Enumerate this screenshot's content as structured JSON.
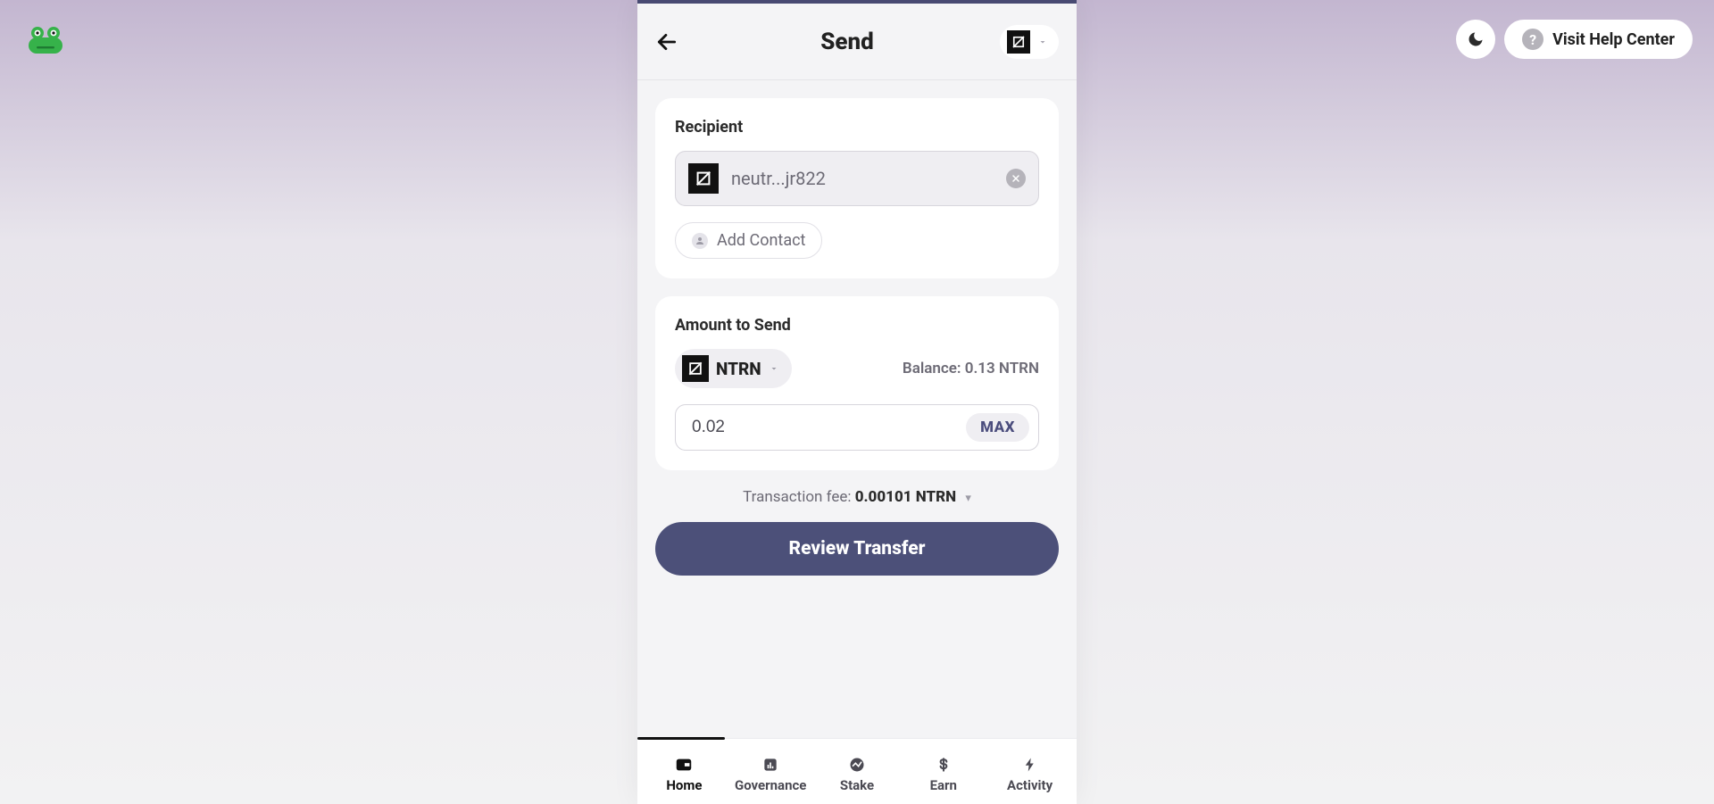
{
  "header": {
    "title": "Send"
  },
  "topbar": {
    "help_label": "Visit Help Center"
  },
  "recipient": {
    "label": "Recipient",
    "address_short": "neutr...jr822",
    "add_contact_label": "Add Contact"
  },
  "amount": {
    "label": "Amount to Send",
    "token_symbol": "NTRN",
    "balance_label": "Balance: 0.13 NTRN",
    "value": "0.02",
    "max_label": "MAX"
  },
  "fee": {
    "label": "Transaction fee: ",
    "value": "0.00101 NTRN"
  },
  "actions": {
    "review_label": "Review Transfer"
  },
  "nav": {
    "items": [
      {
        "label": "Home"
      },
      {
        "label": "Governance"
      },
      {
        "label": "Stake"
      },
      {
        "label": "Earn"
      },
      {
        "label": "Activity"
      }
    ]
  }
}
